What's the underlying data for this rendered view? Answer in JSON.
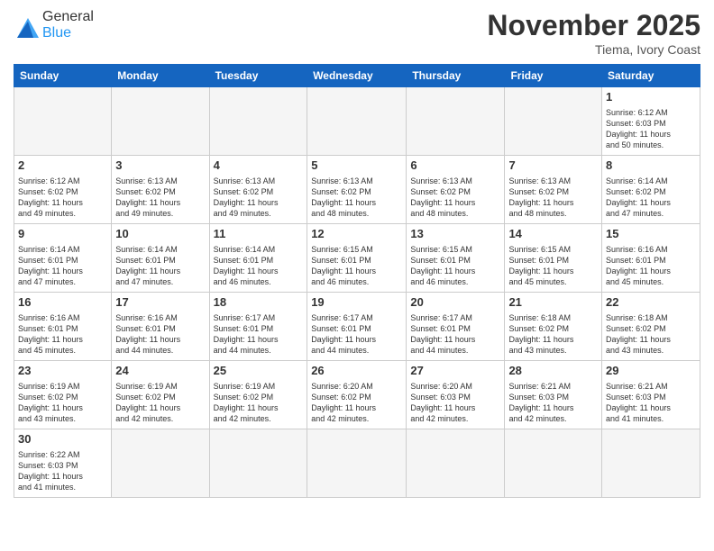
{
  "header": {
    "logo_general": "General",
    "logo_blue": "Blue",
    "month_title": "November 2025",
    "location": "Tiema, Ivory Coast"
  },
  "days_of_week": [
    "Sunday",
    "Monday",
    "Tuesday",
    "Wednesday",
    "Thursday",
    "Friday",
    "Saturday"
  ],
  "weeks": [
    [
      {
        "day": "",
        "info": ""
      },
      {
        "day": "",
        "info": ""
      },
      {
        "day": "",
        "info": ""
      },
      {
        "day": "",
        "info": ""
      },
      {
        "day": "",
        "info": ""
      },
      {
        "day": "",
        "info": ""
      },
      {
        "day": "1",
        "info": "Sunrise: 6:12 AM\nSunset: 6:03 PM\nDaylight: 11 hours\nand 50 minutes."
      }
    ],
    [
      {
        "day": "2",
        "info": "Sunrise: 6:12 AM\nSunset: 6:02 PM\nDaylight: 11 hours\nand 49 minutes."
      },
      {
        "day": "3",
        "info": "Sunrise: 6:13 AM\nSunset: 6:02 PM\nDaylight: 11 hours\nand 49 minutes."
      },
      {
        "day": "4",
        "info": "Sunrise: 6:13 AM\nSunset: 6:02 PM\nDaylight: 11 hours\nand 49 minutes."
      },
      {
        "day": "5",
        "info": "Sunrise: 6:13 AM\nSunset: 6:02 PM\nDaylight: 11 hours\nand 48 minutes."
      },
      {
        "day": "6",
        "info": "Sunrise: 6:13 AM\nSunset: 6:02 PM\nDaylight: 11 hours\nand 48 minutes."
      },
      {
        "day": "7",
        "info": "Sunrise: 6:13 AM\nSunset: 6:02 PM\nDaylight: 11 hours\nand 48 minutes."
      },
      {
        "day": "8",
        "info": "Sunrise: 6:14 AM\nSunset: 6:02 PM\nDaylight: 11 hours\nand 47 minutes."
      }
    ],
    [
      {
        "day": "9",
        "info": "Sunrise: 6:14 AM\nSunset: 6:01 PM\nDaylight: 11 hours\nand 47 minutes."
      },
      {
        "day": "10",
        "info": "Sunrise: 6:14 AM\nSunset: 6:01 PM\nDaylight: 11 hours\nand 47 minutes."
      },
      {
        "day": "11",
        "info": "Sunrise: 6:14 AM\nSunset: 6:01 PM\nDaylight: 11 hours\nand 46 minutes."
      },
      {
        "day": "12",
        "info": "Sunrise: 6:15 AM\nSunset: 6:01 PM\nDaylight: 11 hours\nand 46 minutes."
      },
      {
        "day": "13",
        "info": "Sunrise: 6:15 AM\nSunset: 6:01 PM\nDaylight: 11 hours\nand 46 minutes."
      },
      {
        "day": "14",
        "info": "Sunrise: 6:15 AM\nSunset: 6:01 PM\nDaylight: 11 hours\nand 45 minutes."
      },
      {
        "day": "15",
        "info": "Sunrise: 6:16 AM\nSunset: 6:01 PM\nDaylight: 11 hours\nand 45 minutes."
      }
    ],
    [
      {
        "day": "16",
        "info": "Sunrise: 6:16 AM\nSunset: 6:01 PM\nDaylight: 11 hours\nand 45 minutes."
      },
      {
        "day": "17",
        "info": "Sunrise: 6:16 AM\nSunset: 6:01 PM\nDaylight: 11 hours\nand 44 minutes."
      },
      {
        "day": "18",
        "info": "Sunrise: 6:17 AM\nSunset: 6:01 PM\nDaylight: 11 hours\nand 44 minutes."
      },
      {
        "day": "19",
        "info": "Sunrise: 6:17 AM\nSunset: 6:01 PM\nDaylight: 11 hours\nand 44 minutes."
      },
      {
        "day": "20",
        "info": "Sunrise: 6:17 AM\nSunset: 6:01 PM\nDaylight: 11 hours\nand 44 minutes."
      },
      {
        "day": "21",
        "info": "Sunrise: 6:18 AM\nSunset: 6:02 PM\nDaylight: 11 hours\nand 43 minutes."
      },
      {
        "day": "22",
        "info": "Sunrise: 6:18 AM\nSunset: 6:02 PM\nDaylight: 11 hours\nand 43 minutes."
      }
    ],
    [
      {
        "day": "23",
        "info": "Sunrise: 6:19 AM\nSunset: 6:02 PM\nDaylight: 11 hours\nand 43 minutes."
      },
      {
        "day": "24",
        "info": "Sunrise: 6:19 AM\nSunset: 6:02 PM\nDaylight: 11 hours\nand 42 minutes."
      },
      {
        "day": "25",
        "info": "Sunrise: 6:19 AM\nSunset: 6:02 PM\nDaylight: 11 hours\nand 42 minutes."
      },
      {
        "day": "26",
        "info": "Sunrise: 6:20 AM\nSunset: 6:02 PM\nDaylight: 11 hours\nand 42 minutes."
      },
      {
        "day": "27",
        "info": "Sunrise: 6:20 AM\nSunset: 6:03 PM\nDaylight: 11 hours\nand 42 minutes."
      },
      {
        "day": "28",
        "info": "Sunrise: 6:21 AM\nSunset: 6:03 PM\nDaylight: 11 hours\nand 42 minutes."
      },
      {
        "day": "29",
        "info": "Sunrise: 6:21 AM\nSunset: 6:03 PM\nDaylight: 11 hours\nand 41 minutes."
      }
    ],
    [
      {
        "day": "30",
        "info": "Sunrise: 6:22 AM\nSunset: 6:03 PM\nDaylight: 11 hours\nand 41 minutes."
      },
      {
        "day": "",
        "info": ""
      },
      {
        "day": "",
        "info": ""
      },
      {
        "day": "",
        "info": ""
      },
      {
        "day": "",
        "info": ""
      },
      {
        "day": "",
        "info": ""
      },
      {
        "day": "",
        "info": ""
      }
    ]
  ]
}
